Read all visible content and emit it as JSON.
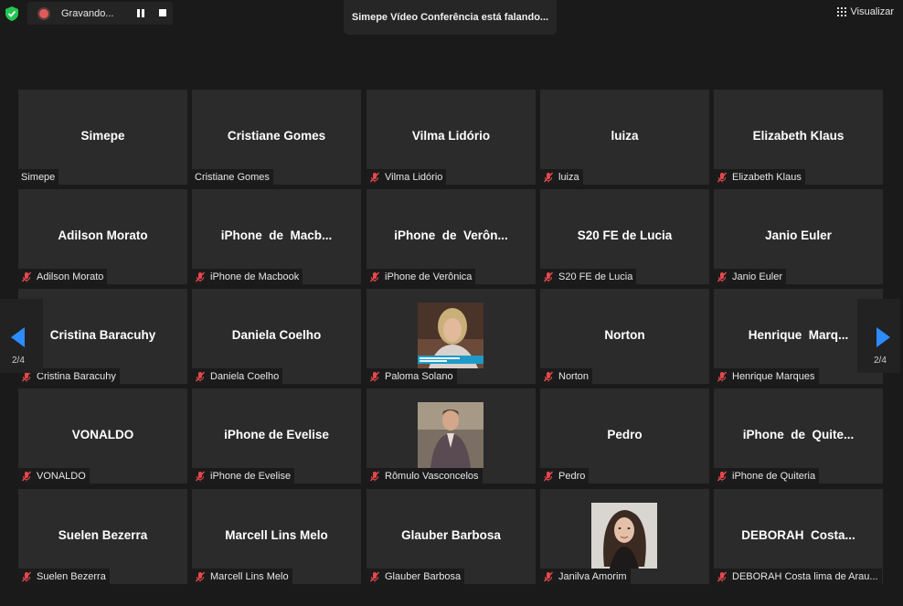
{
  "recording": {
    "label": "Gravando..."
  },
  "speaking_banner": "Simepe Vídeo Conferência está falando...",
  "view_button": {
    "label": "Visualizar"
  },
  "pagination": {
    "left_label": "2/4",
    "right_label": "2/4"
  },
  "colors": {
    "mute_icon": "#e5484d",
    "nav_arrow": "#2d8cff",
    "record_dot": "#e25b5b",
    "shield": "#23c552"
  },
  "participants": [
    {
      "name": "Simepe",
      "label": "Simepe",
      "muted": false
    },
    {
      "name": "Cristiane Gomes",
      "label": "Cristiane Gomes",
      "muted": false
    },
    {
      "name": "Vilma Lidório",
      "label": "Vilma Lidório",
      "muted": true
    },
    {
      "name": "luiza",
      "label": "luiza",
      "muted": true
    },
    {
      "name": "Elizabeth Klaus",
      "label": "Elizabeth Klaus",
      "muted": true
    },
    {
      "name": "Adilson Morato",
      "label": "Adilson Morato",
      "muted": true
    },
    {
      "name": "iPhone  de  Macb...",
      "label": "iPhone de Macbook",
      "muted": true
    },
    {
      "name": "iPhone  de  Verôn...",
      "label": "iPhone de Verônica",
      "muted": true
    },
    {
      "name": "S20 FE de Lucia",
      "label": "S20 FE de Lucia",
      "muted": true
    },
    {
      "name": "Janio Euler",
      "label": "Janio Euler",
      "muted": true
    },
    {
      "name": "Cristina Baracuhy",
      "label": "Cristina Baracuhy",
      "muted": true
    },
    {
      "name": "Daniela Coelho",
      "label": "Daniela Coelho",
      "muted": true
    },
    {
      "name": "",
      "label": "Paloma Solano",
      "muted": true,
      "photo": "photo-woman-news"
    },
    {
      "name": "Norton",
      "label": "Norton",
      "muted": true
    },
    {
      "name": "Henrique  Marq...",
      "label": "Henrique Marques",
      "muted": true
    },
    {
      "name": "VONALDO",
      "label": "VONALDO",
      "muted": true
    },
    {
      "name": "iPhone de Evelise",
      "label": "iPhone de Evelise",
      "muted": true
    },
    {
      "name": "",
      "label": "Rômulo Vasconcelos",
      "muted": true,
      "photo": "photo-man-suit"
    },
    {
      "name": "Pedro",
      "label": "Pedro",
      "muted": true
    },
    {
      "name": "iPhone  de  Quite...",
      "label": "iPhone de Quiteria",
      "muted": true
    },
    {
      "name": "Suelen Bezerra",
      "label": "Suelen Bezerra",
      "muted": true
    },
    {
      "name": "Marcell Lins Melo",
      "label": "Marcell Lins Melo",
      "muted": true
    },
    {
      "name": "Glauber Barbosa",
      "label": "Glauber Barbosa",
      "muted": true
    },
    {
      "name": "",
      "label": "Janilva Amorim",
      "muted": true,
      "photo": "photo-woman-portrait"
    },
    {
      "name": "DEBORAH  Costa...",
      "label": "DEBORAH Costa lima de Arau...",
      "muted": true
    }
  ]
}
